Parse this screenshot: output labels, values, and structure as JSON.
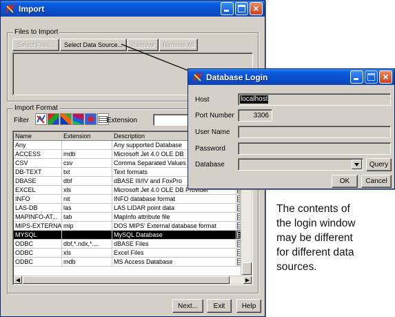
{
  "import_window": {
    "title": "Import",
    "files_group_label": "Files to Import",
    "buttons": {
      "select_files": "Select Files...",
      "select_data_source": "Select Data Source...",
      "remove": "Remove",
      "remove_all": "Remove All"
    },
    "format_group_label": "Import Format",
    "filter_label": "Filter",
    "extension_label": "Extension",
    "table": {
      "headers": [
        "Name",
        "Extension",
        "Description"
      ],
      "rows": [
        {
          "name": "Any",
          "ext": "",
          "desc": "Any supported Database"
        },
        {
          "name": "ACCESS",
          "ext": "mdb",
          "desc": "Microsoft Jet 4.0 OLE DB"
        },
        {
          "name": "CSV",
          "ext": "csv",
          "desc": "Comma Separated Values"
        },
        {
          "name": "DB-TEXT",
          "ext": "txt",
          "desc": "Text formats"
        },
        {
          "name": "DBASE",
          "ext": "dbf",
          "desc": "dBASE III/IV and FoxPro"
        },
        {
          "name": "EXCEL",
          "ext": "xls",
          "desc": "Microsoft Jet 4.0 OLE DB Provider"
        },
        {
          "name": "INFO",
          "ext": "nit",
          "desc": "INFO database format"
        },
        {
          "name": "LAS-DB",
          "ext": "las",
          "desc": "LAS LIDAR point data"
        },
        {
          "name": "MAPINFO-AT...",
          "ext": "tab",
          "desc": "MapInfo attribute file"
        },
        {
          "name": "MIPS-EXTERNAL",
          "ext": "mip",
          "desc": "DOS MIPS' External database format"
        },
        {
          "name": "MYSQL",
          "ext": "",
          "desc": "MySQL Database"
        },
        {
          "name": "ODBC",
          "ext": "dbf,*.ndx,*....",
          "desc": "dBASE Files"
        },
        {
          "name": "ODBC",
          "ext": "xls",
          "desc": "Excel Files"
        },
        {
          "name": "ODBC",
          "ext": "mdb",
          "desc": "MS Access Database"
        }
      ],
      "selected_index": 10
    },
    "footer": {
      "next": "Next...",
      "exit": "Exit",
      "help": "Help"
    }
  },
  "login_window": {
    "title": "Database Login",
    "fields": {
      "host_label": "Host",
      "host_value": "localhost",
      "port_label": "Port Number",
      "port_value": "3306",
      "user_label": "User Name",
      "user_value": "",
      "password_label": "Password",
      "password_value": "",
      "database_label": "Database",
      "database_value": ""
    },
    "buttons": {
      "query": "Query",
      "ok": "OK",
      "cancel": "Cancel"
    }
  },
  "note": {
    "lines": [
      "The contents of",
      "the login window",
      "may be different",
      "for different data",
      "sources."
    ]
  },
  "colors": {
    "title_blue": "#0a5ee0",
    "window_face": "#d4d0c8",
    "selection": "#000000"
  }
}
